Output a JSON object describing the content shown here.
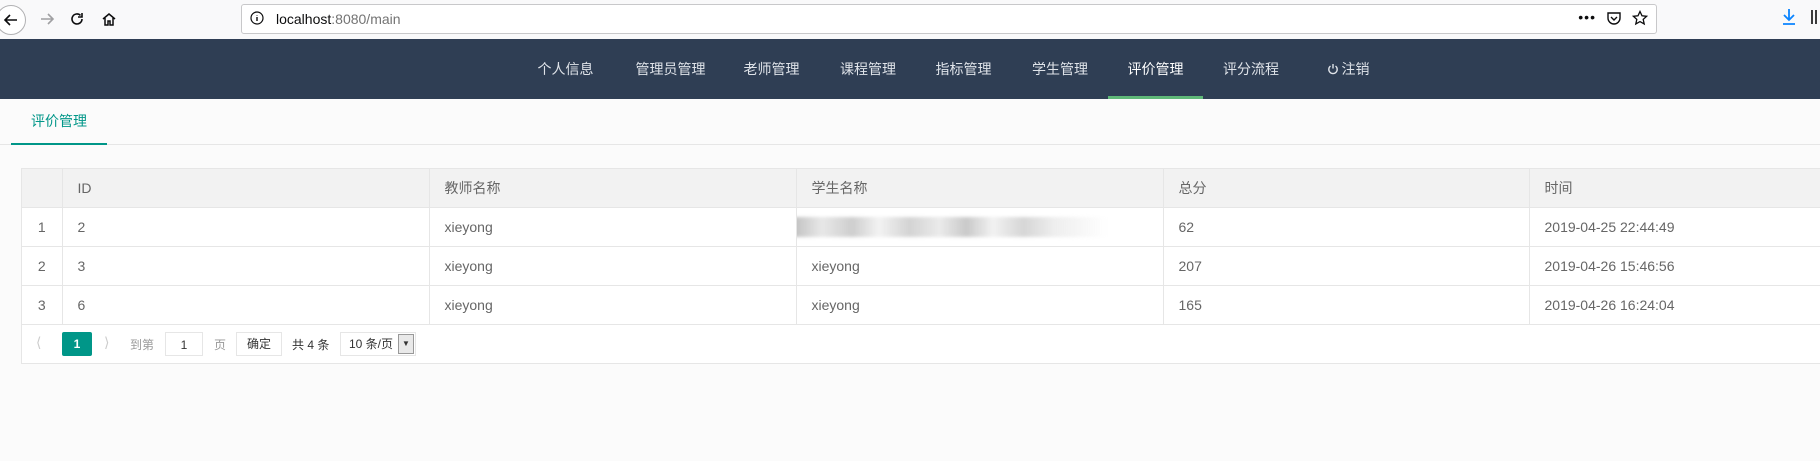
{
  "browser": {
    "url_host": "localhost",
    "url_rest": ":8080/main",
    "more_label": "•••"
  },
  "nav": {
    "items": [
      {
        "label": "个人信息"
      },
      {
        "label": "管理员管理"
      },
      {
        "label": "老师管理"
      },
      {
        "label": "课程管理"
      },
      {
        "label": "指标管理"
      },
      {
        "label": "学生管理"
      },
      {
        "label": "评价管理",
        "active": true
      },
      {
        "label": "评分流程"
      },
      {
        "label": "注销",
        "icon": "power-icon"
      }
    ]
  },
  "subtab": {
    "label": "评价管理"
  },
  "table": {
    "headers": [
      "",
      "ID",
      "教师名称",
      "学生名称",
      "总分",
      "时间"
    ],
    "rows": [
      {
        "num": "1",
        "id": "2",
        "teacher": "xieyong",
        "student": "",
        "score": "62",
        "time": "2019-04-25 22:44:49"
      },
      {
        "num": "2",
        "id": "3",
        "teacher": "xieyong",
        "student": "xieyong",
        "score": "207",
        "time": "2019-04-26 15:46:56"
      },
      {
        "num": "3",
        "id": "6",
        "teacher": "xieyong",
        "student": "xieyong",
        "score": "165",
        "time": "2019-04-26 16:24:04"
      }
    ]
  },
  "pager": {
    "current": "1",
    "goto_label": "到第",
    "input_value": "1",
    "page_label": "页",
    "confirm_label": "确定",
    "total_label": "共 4 条",
    "page_size": "10 条/页"
  },
  "colors": {
    "nav_bg": "#2f3e54",
    "accent": "#009688",
    "active_underline": "#5fb878"
  }
}
